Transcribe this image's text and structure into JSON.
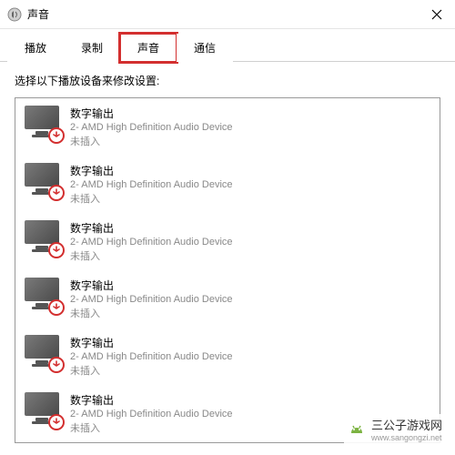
{
  "window": {
    "title": "声音"
  },
  "tabs": {
    "items": [
      {
        "label": "播放",
        "active": false,
        "highlighted": false
      },
      {
        "label": "录制",
        "active": false,
        "highlighted": false
      },
      {
        "label": "声音",
        "active": true,
        "highlighted": true
      },
      {
        "label": "通信",
        "active": false,
        "highlighted": false
      }
    ]
  },
  "content": {
    "instruction": "选择以下播放设备来修改设置:"
  },
  "devices": [
    {
      "name": "数字输出",
      "desc": "2- AMD High Definition Audio Device",
      "status": "未插入"
    },
    {
      "name": "数字输出",
      "desc": "2- AMD High Definition Audio Device",
      "status": "未插入"
    },
    {
      "name": "数字输出",
      "desc": "2- AMD High Definition Audio Device",
      "status": "未插入"
    },
    {
      "name": "数字输出",
      "desc": "2- AMD High Definition Audio Device",
      "status": "未插入"
    },
    {
      "name": "数字输出",
      "desc": "2- AMD High Definition Audio Device",
      "status": "未插入"
    },
    {
      "name": "数字输出",
      "desc": "2- AMD High Definition Audio Device",
      "status": "未插入"
    }
  ],
  "watermark": {
    "text": "三公子游戏网",
    "url": "www.sangongzi.net"
  }
}
